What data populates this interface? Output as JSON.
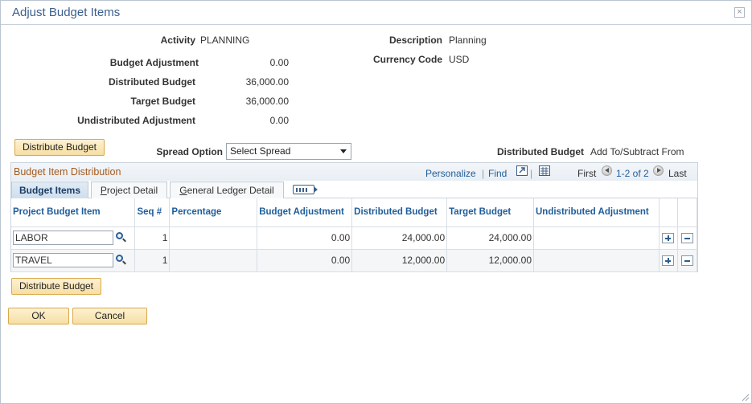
{
  "window": {
    "title": "Adjust Budget Items",
    "close_glyph": "×"
  },
  "summary": {
    "activity_label": "Activity",
    "activity_value": "PLANNING",
    "description_label": "Description",
    "description_value": "Planning",
    "currency_label": "Currency Code",
    "currency_value": "USD",
    "budget_adjustment_label": "Budget Adjustment",
    "budget_adjustment_value": "0.00",
    "distributed_budget_label": "Distributed Budget",
    "distributed_budget_value": "36,000.00",
    "target_budget_label": "Target Budget",
    "target_budget_value": "36,000.00",
    "undistributed_label": "Undistributed Adjustment",
    "undistributed_value": "0.00"
  },
  "controls": {
    "distribute_button": "Distribute Budget",
    "spread_option_label": "Spread Option",
    "spread_option_value": "Select Spread",
    "distributed_budget_label": "Distributed Budget",
    "distributed_budget_mode": "Add To/Subtract From"
  },
  "grid": {
    "title": "Budget Item Distribution",
    "personalize": "Personalize",
    "find": "Find",
    "first": "First",
    "range": "1-2 of 2",
    "last": "Last",
    "tabs": [
      "Budget Items",
      "Project Detail",
      "General Ledger Detail"
    ],
    "columns": [
      "Project Budget Item",
      "Seq #",
      "Percentage",
      "Budget Adjustment",
      "Distributed Budget",
      "Target Budget",
      "Undistributed Adjustment"
    ],
    "rows": [
      {
        "item": "LABOR",
        "seq": "1",
        "percentage": "",
        "budget_adjustment": "0.00",
        "distributed_budget": "24,000.00",
        "target_budget": "24,000.00",
        "undistributed": ""
      },
      {
        "item": "TRAVEL",
        "seq": "1",
        "percentage": "",
        "budget_adjustment": "0.00",
        "distributed_budget": "12,000.00",
        "target_budget": "12,000.00",
        "undistributed": ""
      }
    ]
  },
  "footer": {
    "distribute_button": "Distribute Budget",
    "ok_button": "OK",
    "cancel_button": "Cancel"
  },
  "colors": {
    "accent": "#1f5d9a",
    "button_bg": "#f7dfa2",
    "button_border": "#d9a84a",
    "grid_title": "#a65a1e"
  },
  "icons": [
    "close-icon",
    "lookup-icon",
    "zoom-icon",
    "download-icon",
    "show-all-columns-icon",
    "previous-icon",
    "next-icon",
    "add-row-icon",
    "delete-row-icon"
  ]
}
